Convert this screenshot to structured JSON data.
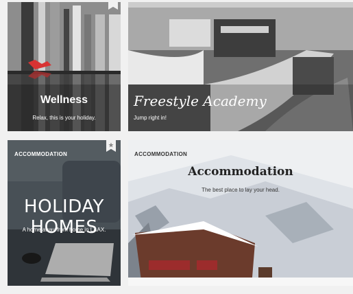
{
  "cards": {
    "wellness": {
      "title": "Wellness",
      "subtitle": "Relax, this is your holiday."
    },
    "freestyle": {
      "title": "Freestyle Academy",
      "subtitle": "Jump right in!"
    },
    "holiday": {
      "tag": "ACCOMMODATION",
      "title": "HOLIDAY HOMES",
      "subtitle": "A home away from home in LAAX.",
      "bookmark_icon": "star-icon"
    },
    "accommodation": {
      "tag": "ACCOMMODATION",
      "title": "Accommodation",
      "subtitle": "The best place to lay your head."
    }
  }
}
